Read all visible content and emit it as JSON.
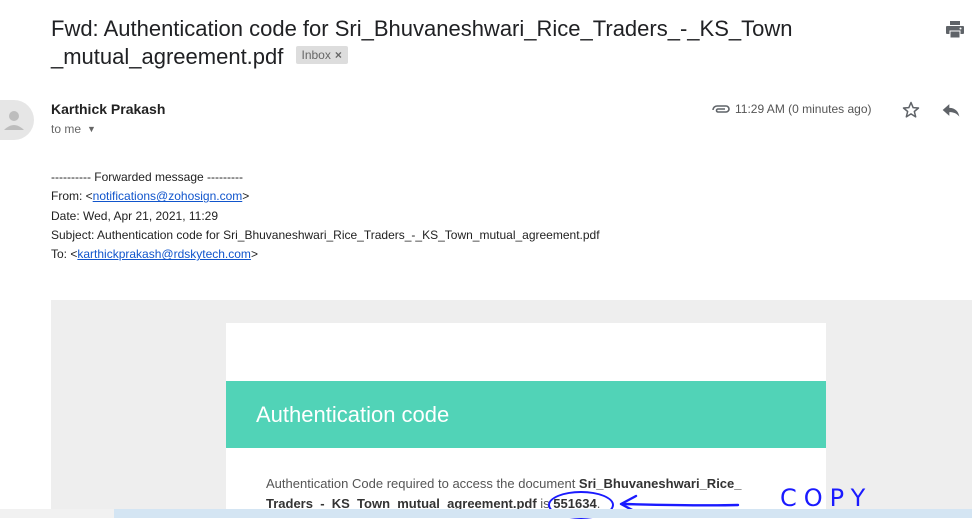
{
  "email": {
    "subject": "Fwd: Authentication code for Sri_Bhuvaneshwari_Rice_Traders_-_KS_Town _mutual_agreement.pdf",
    "label": "Inbox",
    "label_close": "×",
    "sender": "Karthick Prakash",
    "to_line": "to me",
    "time": "11:29 AM (0 minutes ago)"
  },
  "forwarded": {
    "header": "---------- Forwarded message ---------",
    "from_label": "From: <",
    "from_email": "notifications@zohosign.com",
    "from_suffix": ">",
    "date": "Date: Wed, Apr 21, 2021, 11:29",
    "subject": "Subject: Authentication code for Sri_Bhuvaneshwari_Rice_Traders_-_KS_Town_mutual_agreement.pdf",
    "to_label": "To: <",
    "to_email": "karthickprakash@rdskytech.com",
    "to_suffix": ">"
  },
  "card": {
    "heading": "Authentication code",
    "text_before": "Authentication Code required to access the document ",
    "doc_name": "Sri_Bhuvaneshwari_Rice_ Traders_-_KS_Town_mutual_agreement.pdf",
    "text_is": " is ",
    "code": "551634",
    "text_end": "."
  },
  "annotation": {
    "text": "COPY",
    "color": "#1a1aff"
  },
  "colors": {
    "accent": "#51d3b7",
    "link": "#1155cc"
  },
  "icons": [
    "print-icon",
    "avatar-icon",
    "caret-down-icon",
    "attachment-icon",
    "star-icon",
    "reply-icon"
  ]
}
